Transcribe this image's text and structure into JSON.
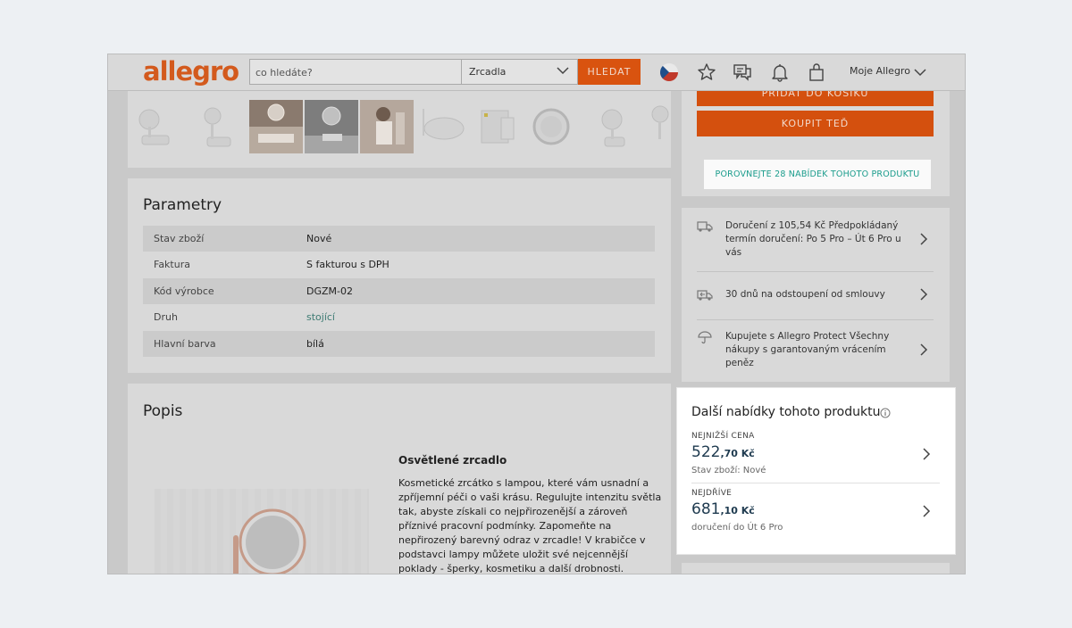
{
  "header": {
    "logo": "allegro",
    "search_placeholder": "co hledáte?",
    "category": "Zrcadla",
    "search_button": "HLEDAT",
    "account": "Moje Allegro"
  },
  "parameters": {
    "title": "Parametry",
    "rows": [
      {
        "key": "Stav zboží",
        "value": "Nové"
      },
      {
        "key": "Faktura",
        "value": "S fakturou s DPH"
      },
      {
        "key": "Kód výrobce",
        "value": "DGZM-02"
      },
      {
        "key": "Druh",
        "value": "stojící"
      },
      {
        "key": "Hlavní barva",
        "value": "bílá"
      }
    ]
  },
  "description": {
    "title": "Popis",
    "heading": "Osvětlené zrcadlo",
    "text": "Kosmetické zrcátko s lampou, které vám usnadní a zpříjemní péči o vaši krásu. Regulujte intenzitu světla tak, abyste získali co nejpřirozenější a zároveň příznivé pracovní podmínky. Zapomeňte na nepřirozený barevný odraz v zrcadle! V krabičce v podstavci lampy můžete uložit své nejcennější poklady - šperky, kosmetiku a další drobnosti."
  },
  "buy": {
    "add_to_cart": "PŘIDAT DO KOŠÍKU",
    "buy_now": "KOUPIT TEĎ",
    "compare": "POROVNEJTE 28 NABÍDEK TOHOTO PRODUKTU"
  },
  "delivery": {
    "rows": [
      {
        "icon": "truck-icon",
        "text": "Doručení z 105,54 Kč Předpokládaný termín doručení: Po 5 Pro – Út 6 Pro u vás"
      },
      {
        "icon": "return-truck-icon",
        "text": "30 dnů na odstoupení od smlouvy"
      },
      {
        "icon": "umbrella-icon",
        "text": "Kupujete s Allegro Protect Všechny nákupy s garantovaným vrácením peněz"
      }
    ]
  },
  "offers": {
    "title": "Další nabídky tohoto produktu",
    "items": [
      {
        "label": "NEJNIŽŠÍ CENA",
        "price_main": "522",
        "price_rest": ",70 Kč",
        "sub": "Stav zboží: Nové"
      },
      {
        "label": "NEJDŘÍVE",
        "price_main": "681",
        "price_rest": ",10 Kč",
        "sub": "doručení do Út 6 Pro"
      }
    ]
  },
  "icons": [
    "flag-cz-icon",
    "star-icon",
    "chat-icon",
    "bell-icon",
    "bag-icon",
    "chevron-down-icon",
    "chevron-right-icon",
    "info-icon"
  ],
  "colors": {
    "brand": "#d35a1d",
    "button": "#d9530f",
    "link": "#1a9c8c",
    "price": "#1e3a4f"
  }
}
